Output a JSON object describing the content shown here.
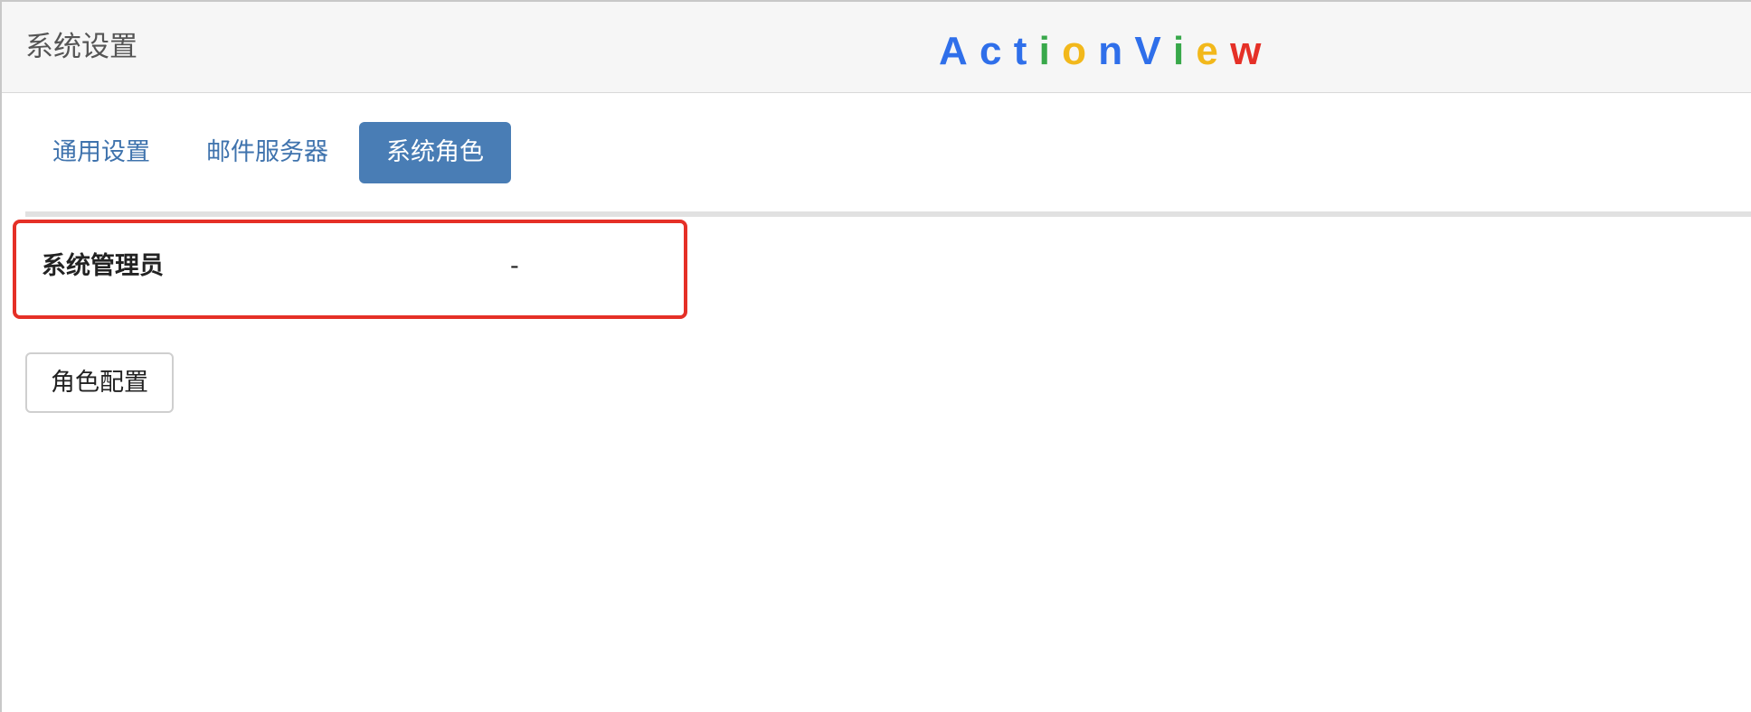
{
  "header": {
    "title": "系统设置",
    "logo": {
      "letters": [
        {
          "char": "A",
          "color": "#2f6fea"
        },
        {
          "char": "c",
          "color": "#2f6fea"
        },
        {
          "char": "t",
          "color": "#2f6fea"
        },
        {
          "char": "i",
          "color": "#38a84a"
        },
        {
          "char": "o",
          "color": "#f2b81b"
        },
        {
          "char": "n",
          "color": "#2f6fea"
        },
        {
          "char": "V",
          "color": "#2f6fea"
        },
        {
          "char": "i",
          "color": "#38a84a"
        },
        {
          "char": "e",
          "color": "#f2b81b"
        },
        {
          "char": "w",
          "color": "#e53027"
        }
      ]
    }
  },
  "tabs": [
    {
      "label": "通用设置",
      "active": false
    },
    {
      "label": "邮件服务器",
      "active": false
    },
    {
      "label": "系统角色",
      "active": true
    }
  ],
  "roles": [
    {
      "name": "系统管理员",
      "value": "-"
    }
  ],
  "buttons": {
    "role_config": "角色配置"
  },
  "colors": {
    "active_tab_bg": "#497db5",
    "tab_text": "#3f73ad",
    "highlight_border": "#e53027"
  }
}
